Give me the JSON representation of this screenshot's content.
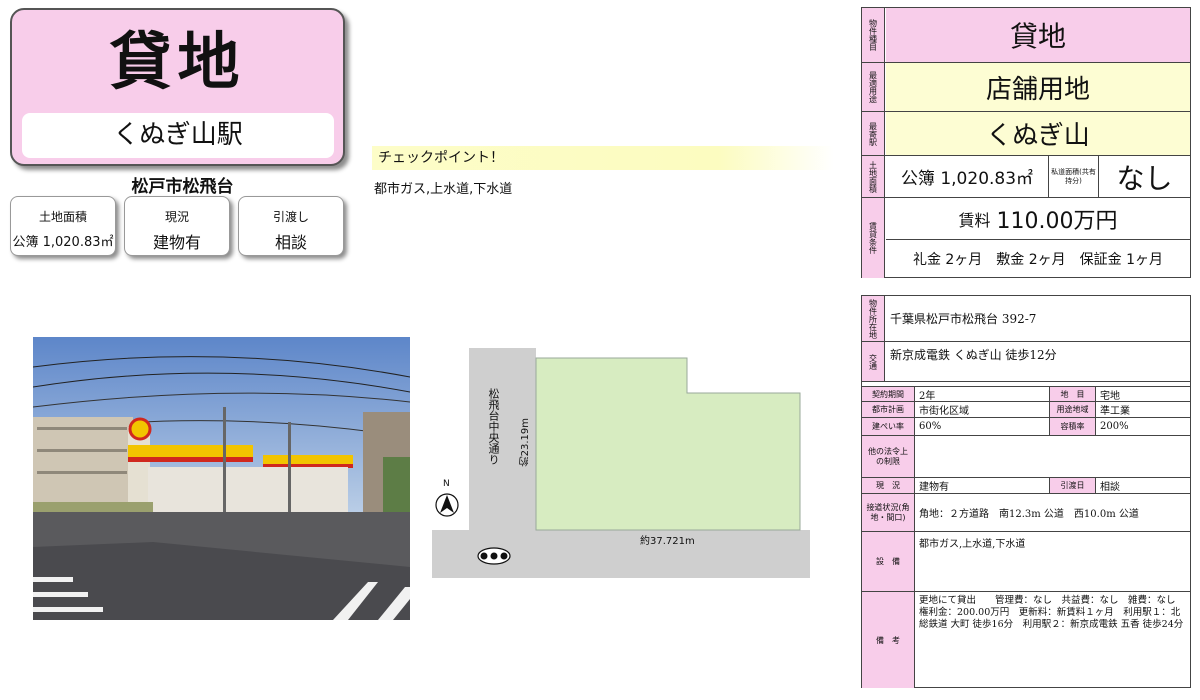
{
  "title_card": {
    "type": "貸地",
    "station": "くぬぎ山駅"
  },
  "city": "松戸市松飛台",
  "summary": [
    {
      "label": "土地面積",
      "value": "公簿 1,020.83㎡"
    },
    {
      "label": "現況",
      "value": "建物有"
    },
    {
      "label": "引渡し",
      "value": "相談"
    }
  ],
  "checkpoint": {
    "heading": "チェックポイント！",
    "text": "都市ガス,上水道,下水道"
  },
  "plot": {
    "road_name": "松飛台中央通り",
    "side_length": "約23.19m",
    "front_length": "約37.721m",
    "north": "N"
  },
  "colors": {
    "pink": "#f8cdea",
    "yellow": "#fdfdd3",
    "plot_green": "#d7ecc1"
  },
  "panel": {
    "type_label": "物件種目",
    "type_value": "貸地",
    "use_label": "最適用途",
    "use_value": "店舗用地",
    "station_label": "最寄駅",
    "station_value": "くぬぎ山",
    "area_label": "土地面積",
    "area_value": "公簿 1,020.83㎡",
    "private_road_label": "私道面積(共有持分)",
    "private_road_value": "なし",
    "rent_label": "賃貸条件",
    "rent_prefix": "賃料",
    "rent_value": "110.00万円",
    "deposits": "礼金 2ヶ月　敷金 2ヶ月　保証金 1ヶ月",
    "address_label": "物件所在地",
    "address_value": "千葉県松戸市松飛台 392-7",
    "access_label": "交通",
    "access_value": "新京成電鉄 くぬぎ山 徒歩12分",
    "contract_label": "契約期間",
    "contract_value": "2年",
    "land_cat_label": "地　目",
    "land_cat_value": "宅地",
    "city_plan_label": "都市計画",
    "city_plan_value": "市街化区域",
    "zoning_label": "用途地域",
    "zoning_value": "準工業",
    "bcr_label": "建ぺい率",
    "bcr_value": "60%",
    "far_label": "容積率",
    "far_value": "200%",
    "other_label": "他の法令上の制限",
    "other_value": "",
    "status_label": "現　況",
    "status_value": "建物有",
    "handover_label": "引渡日",
    "handover_value": "相談",
    "road_label": "接道状況(角地・間口)",
    "road_value": "角地：２方道路　南12.3m 公道　西10.0m 公道",
    "facility_label": "設　備",
    "facility_value": "都市ガス,上水道,下水道",
    "notes_label": "備　考",
    "notes_value": "更地にて貸出　　管理費：なし　共益費：なし　雑費：なし　権利金：200.00万円　更新料：新賃料１ヶ月　利用駅１：北総鉄道 大町 徒歩16分　利用駅２：新京成電鉄 五香 徒歩24分"
  }
}
